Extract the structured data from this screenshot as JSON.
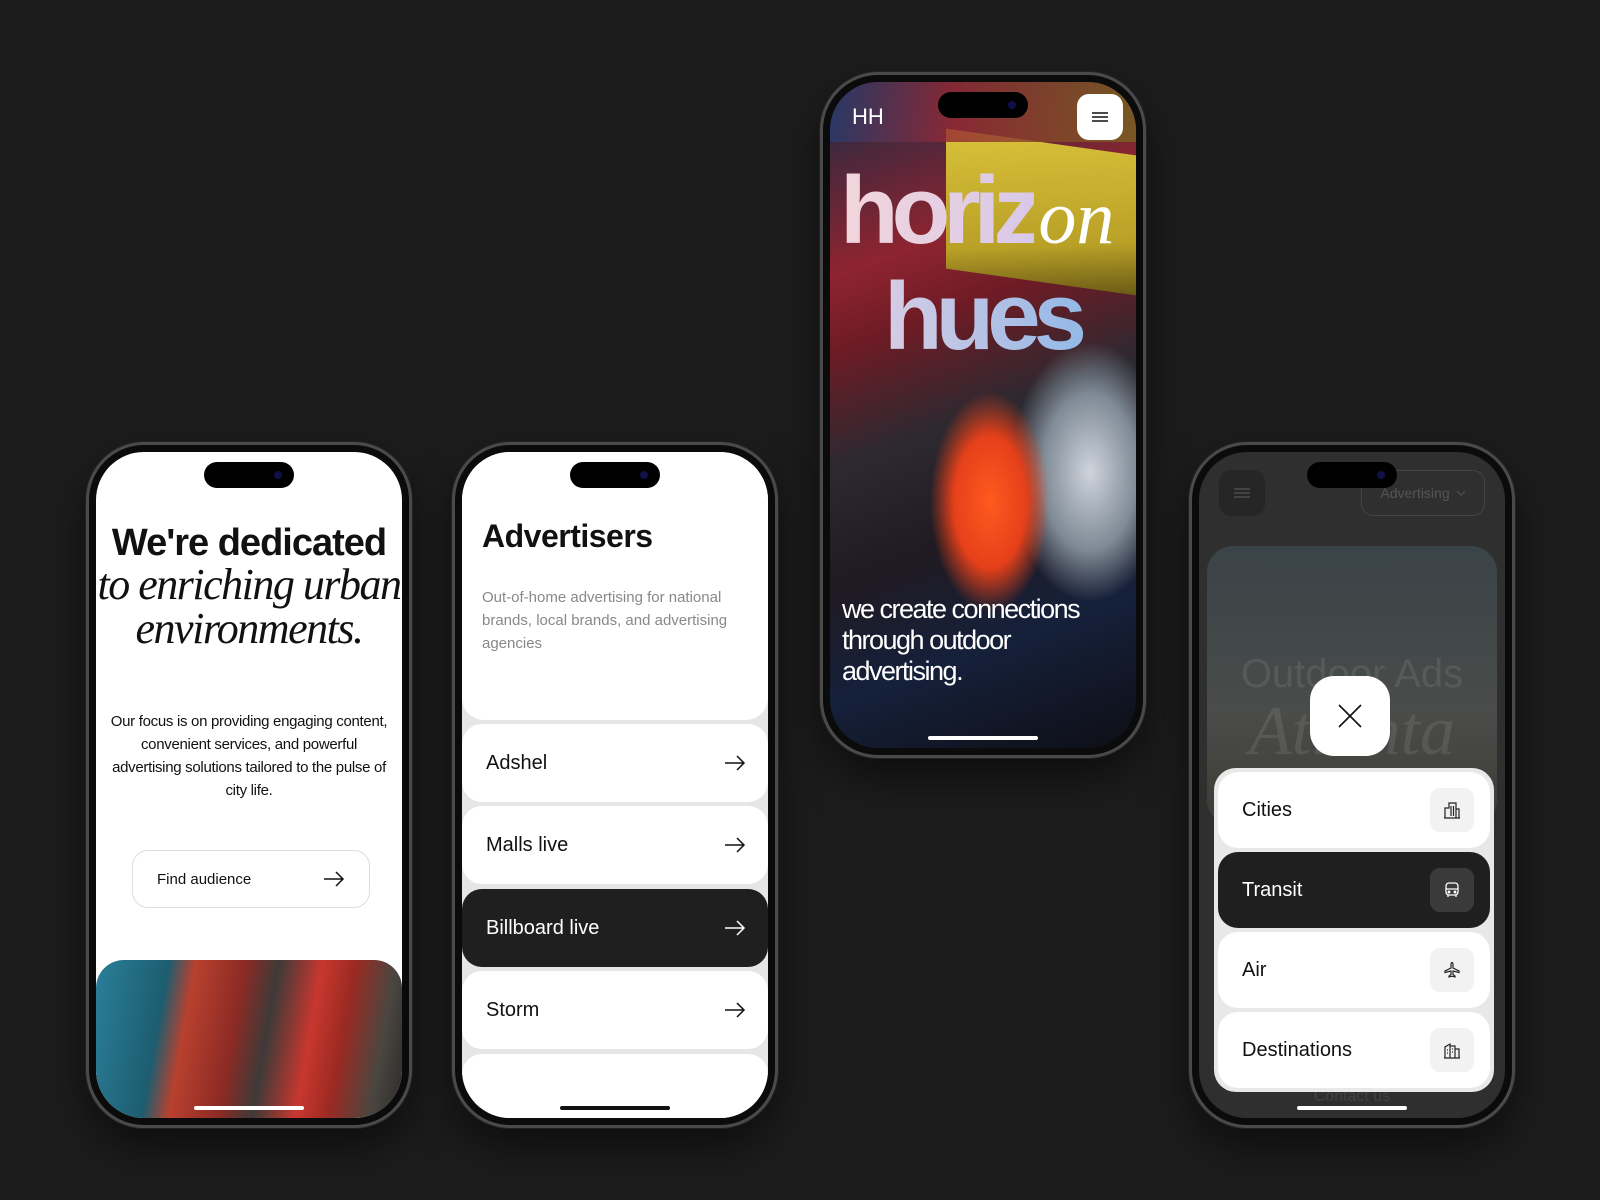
{
  "phone1": {
    "heading_bold": "We're dedicated",
    "heading_italic": "to enriching urban environments.",
    "paragraph": "Our focus is on providing engaging content, convenient services, and powerful advertising solutions tailored to the pulse of city life.",
    "button_label": "Find audience"
  },
  "phone2": {
    "title": "Advertisers",
    "description": "Out-of-home advertising for national brands, local brands, and advertising agencies",
    "items": [
      {
        "label": "Adshel",
        "active": false
      },
      {
        "label": "Malls live",
        "active": false
      },
      {
        "label": "Billboard live",
        "active": true
      },
      {
        "label": "Storm",
        "active": false
      }
    ]
  },
  "phone3": {
    "logo": "HH",
    "hero_part1": "horiz",
    "hero_part2": "on",
    "hero_part3": "hues",
    "tagline": "we create connections through outdoor advertising."
  },
  "phone4": {
    "dropdown_label": "Advertising",
    "hero_title": "Outdoor Ads",
    "hero_city": "Atlanta",
    "footer_link": "Contact us",
    "menu_items": [
      {
        "label": "Cities",
        "icon": "building-icon",
        "active": false
      },
      {
        "label": "Transit",
        "icon": "bus-icon",
        "active": true
      },
      {
        "label": "Air",
        "icon": "airplane-icon",
        "active": false
      },
      {
        "label": "Destinations",
        "icon": "destination-building-icon",
        "active": false
      }
    ]
  },
  "colors": {
    "background": "#1c1c1c",
    "dark_item": "#1f1f1f",
    "muted_text": "#888888"
  }
}
